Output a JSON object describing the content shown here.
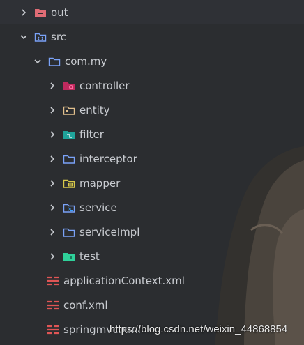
{
  "tree": {
    "items": [
      {
        "label": "out",
        "icon": "excluded-folder-icon",
        "expanded": false
      },
      {
        "label": "src",
        "icon": "source-folder-icon",
        "expanded": true
      },
      {
        "label": "com.my",
        "icon": "package-folder-icon",
        "expanded": true
      },
      {
        "label": "controller",
        "icon": "controller-folder-icon",
        "expanded": false
      },
      {
        "label": "entity",
        "icon": "entity-folder-icon",
        "expanded": false
      },
      {
        "label": "filter",
        "icon": "filter-folder-icon",
        "expanded": false
      },
      {
        "label": "interceptor",
        "icon": "folder-icon",
        "expanded": false
      },
      {
        "label": "mapper",
        "icon": "mapper-folder-icon",
        "expanded": false
      },
      {
        "label": "service",
        "icon": "service-folder-icon",
        "expanded": false
      },
      {
        "label": "serviceImpl",
        "icon": "folder-icon",
        "expanded": false
      },
      {
        "label": "test",
        "icon": "test-folder-icon",
        "expanded": false
      },
      {
        "label": "applicationContext.xml",
        "icon": "xml-file-icon"
      },
      {
        "label": "conf.xml",
        "icon": "xml-file-icon"
      },
      {
        "label": "springmvc.xml",
        "icon": "xml-file-icon"
      }
    ]
  },
  "watermark": "https://blog.csdn.net/weixin_44868854",
  "colors": {
    "background": "#2b2d30",
    "text": "#c9ccd1",
    "folder_blue": "#7aa2f7",
    "excluded_red": "#e06c75",
    "controller_pink": "#e0306f",
    "entity_yellow": "#e2c08d",
    "filter_teal": "#1fa39a",
    "test_green": "#2fd19a",
    "xml_red": "#e05555"
  }
}
